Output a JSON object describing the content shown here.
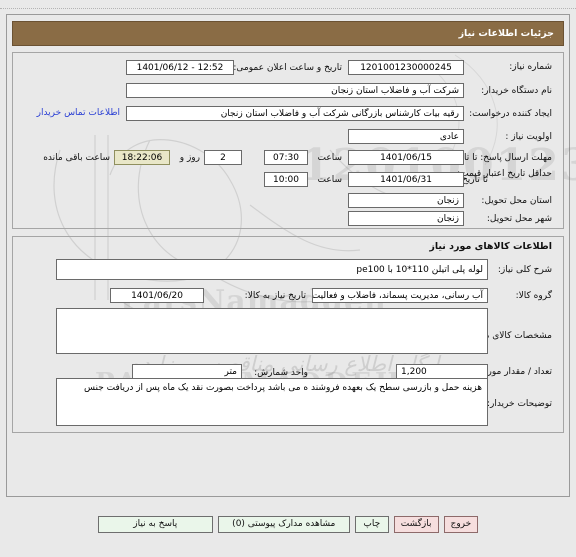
{
  "window": {
    "title": "جزئیات اطلاعات نیاز"
  },
  "watermark": {
    "script_line": "پایگاه اطلاع رسانی مناقصه ها و داده ها",
    "brand_top": "PARSNAMADDEH",
    "brand_mid": "ParsNamaddeh",
    "digits": "1201001230000245",
    "tender_word": "پایگاه اطلاع رسانی مناقصه و مزایده"
  },
  "sections": {
    "need_info": {
      "fields": {
        "need_number": {
          "label": "شماره نیاز:",
          "value": "1201001230000245"
        },
        "public_announce_datetime": {
          "label": "تاریخ و ساعت اعلان عمومی:",
          "value": "1401/06/12 - 12:52"
        },
        "buyer_org": {
          "label": "نام دستگاه خریدار:",
          "value": "شرکت آب و فاضلاب استان زنجان"
        },
        "request_creator": {
          "label": "ایجاد کننده درخواست:",
          "value": "رقیه بیات کارشناس بازرگانی شرکت آب و فاضلاب استان زنجان"
        },
        "buyer_contact_link": "اطلاعات تماس خریدار",
        "priority": {
          "label": "اولویت نیاز :",
          "value": "عادی"
        },
        "reply_deadline": {
          "label": "مهلت ارسال پاسخ: تا تاریخ :",
          "date": "1401/06/15",
          "time_label": "ساعت",
          "time": "07:30",
          "days_remaining": "2",
          "days_sep": "روز و",
          "clock_remaining": "18:22:06",
          "remaining_suffix": "ساعت باقی مانده"
        },
        "price_validity": {
          "label": "حداقل تاریخ اعتبار قیمت:",
          "label_until": "تا تاریخ :",
          "date": "1401/06/31",
          "time_label": "ساعت",
          "time": "10:00"
        },
        "delivery_province": {
          "label": "استان محل تحویل:",
          "value": "زنجان"
        },
        "delivery_city": {
          "label": "شهر محل تحویل:",
          "value": "زنجان"
        }
      }
    },
    "goods_info": {
      "title": "اطلاعات کالاهای مورد نیاز",
      "fields": {
        "general_description": {
          "label": "شرح کلی نیاز:",
          "value": "لوله پلی اتیلن 110*10 با pe100"
        },
        "goods_group": {
          "label": "گروه کالا:",
          "value": "آب رسانی، مدیریت پسماند، فاضلاب و فعالیت ها"
        },
        "needed_date": {
          "label": "تاریخ نیاز به کالا:",
          "value": "1401/06/20"
        },
        "goods_specs": {
          "label": "مشخصات کالای مورد نیاز:",
          "value": ""
        },
        "quantity": {
          "label": "تعداد / مقدار مورد نیاز:",
          "value": "1,200",
          "unit_label": "واحد شمارش:",
          "unit_value": "متر"
        },
        "buyer_notes": {
          "label": "توضیحات خریدار:",
          "value": "هزینه حمل و بازرسی سطح یک بعهده فروشند ه می باشد پرداخت بصورت نقد یک ماه پس از دریافت جنس"
        }
      }
    }
  },
  "buttons": {
    "respond": "پاسخ به نیاز",
    "view_attachments": "مشاهده مدارک پیوستی (0)",
    "print": "چاپ",
    "back": "بازگشت",
    "exit": "خروج"
  },
  "colors": {
    "titlebar_bg": "#8a6c45",
    "link": "#2a3fd4",
    "highlight_bg": "#e9e7c8",
    "danger_bg": "#f6dede",
    "button_bg": "#eaf6ea"
  }
}
